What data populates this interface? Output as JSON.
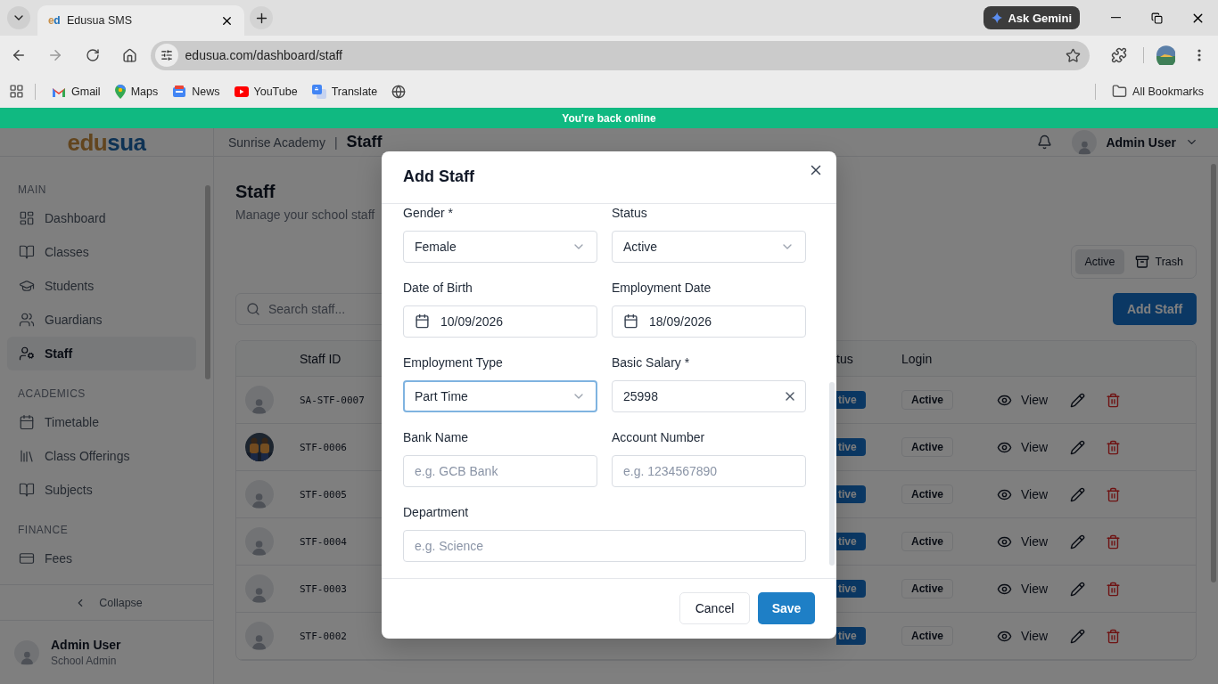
{
  "browser": {
    "tab_favicon": "ed",
    "tab_title": "Edusua SMS",
    "url": "edusua.com/dashboard/staff",
    "ask_button": "Ask Gemini",
    "bookmarks": [
      "Gmail",
      "Maps",
      "News",
      "YouTube",
      "Translate"
    ],
    "all_bookmarks": "All Bookmarks"
  },
  "banner": "You're back online",
  "header": {
    "logo_parts": [
      "edu",
      "sua"
    ],
    "school": "Sunrise Academy",
    "separator": "|",
    "page": "Staff",
    "user": "Admin User"
  },
  "sidebar": {
    "sections": [
      {
        "title": "MAIN",
        "items": [
          {
            "label": "Dashboard",
            "selected": false
          },
          {
            "label": "Classes",
            "selected": false
          },
          {
            "label": "Students",
            "selected": false
          },
          {
            "label": "Guardians",
            "selected": false
          },
          {
            "label": "Staff",
            "selected": true
          }
        ]
      },
      {
        "title": "ACADEMICS",
        "items": [
          {
            "label": "Timetable",
            "selected": false
          },
          {
            "label": "Class Offerings",
            "selected": false
          },
          {
            "label": "Subjects",
            "selected": false
          }
        ]
      },
      {
        "title": "FINANCE",
        "items": [
          {
            "label": "Fees",
            "selected": false
          }
        ]
      }
    ],
    "collapse": "Collapse",
    "user": {
      "name": "Admin User",
      "role": "School Admin"
    }
  },
  "content": {
    "title": "Staff",
    "subtitle": "Manage your school staff",
    "filter": [
      {
        "label": "Active",
        "selected": true
      },
      {
        "label": "Trash",
        "selected": false
      }
    ],
    "search": {
      "placeholder": "Search staff..."
    },
    "add_button": "Add Staff",
    "table": {
      "columns": [
        "Staff ID",
        "tus",
        "Login"
      ],
      "rows": [
        {
          "kind": "placeholder",
          "staff_id": "SA-STF-0007",
          "status": "tive",
          "login": "Active",
          "view": "View"
        },
        {
          "kind": "picture",
          "staff_id": "STF-0006",
          "status": "tive",
          "login": "Active",
          "view": "View"
        },
        {
          "kind": "placeholder",
          "staff_id": "STF-0005",
          "status": "tive",
          "login": "Active",
          "view": "View"
        },
        {
          "kind": "placeholder",
          "staff_id": "STF-0004",
          "status": "tive",
          "login": "Active",
          "view": "View"
        },
        {
          "kind": "placeholder",
          "staff_id": "STF-0003",
          "status": "tive",
          "login": "Active",
          "view": "View"
        },
        {
          "kind": "placeholder",
          "staff_id": "STF-0002",
          "status": "tive",
          "login": "Active",
          "view": "View"
        }
      ]
    }
  },
  "modal": {
    "title": "Add Staff",
    "fields": [
      {
        "kind": "select",
        "label": "Gender *",
        "value": "Female",
        "focused": false,
        "wide": false
      },
      {
        "kind": "select",
        "label": "Status",
        "value": "Active",
        "focused": false,
        "wide": false
      },
      {
        "kind": "date",
        "label": "Date of Birth",
        "value": "10/09/2026",
        "focused": false,
        "wide": false
      },
      {
        "kind": "date",
        "label": "Employment Date",
        "value": "18/09/2026",
        "focused": false,
        "wide": false
      },
      {
        "kind": "select",
        "label": "Employment Type",
        "value": "Part Time",
        "focused": true,
        "wide": false
      },
      {
        "kind": "text",
        "label": "Basic Salary *",
        "value": "25998",
        "clearable": true,
        "focused": false,
        "wide": false
      },
      {
        "kind": "text",
        "label": "Bank Name",
        "placeholder": "e.g. GCB Bank",
        "focused": false,
        "wide": false
      },
      {
        "kind": "text",
        "label": "Account Number",
        "placeholder": "e.g. 1234567890",
        "focused": false,
        "wide": false
      },
      {
        "kind": "text",
        "label": "Department",
        "placeholder": "e.g. Science",
        "focused": false,
        "wide": true
      }
    ],
    "cancel": "Cancel",
    "save": "Save"
  }
}
